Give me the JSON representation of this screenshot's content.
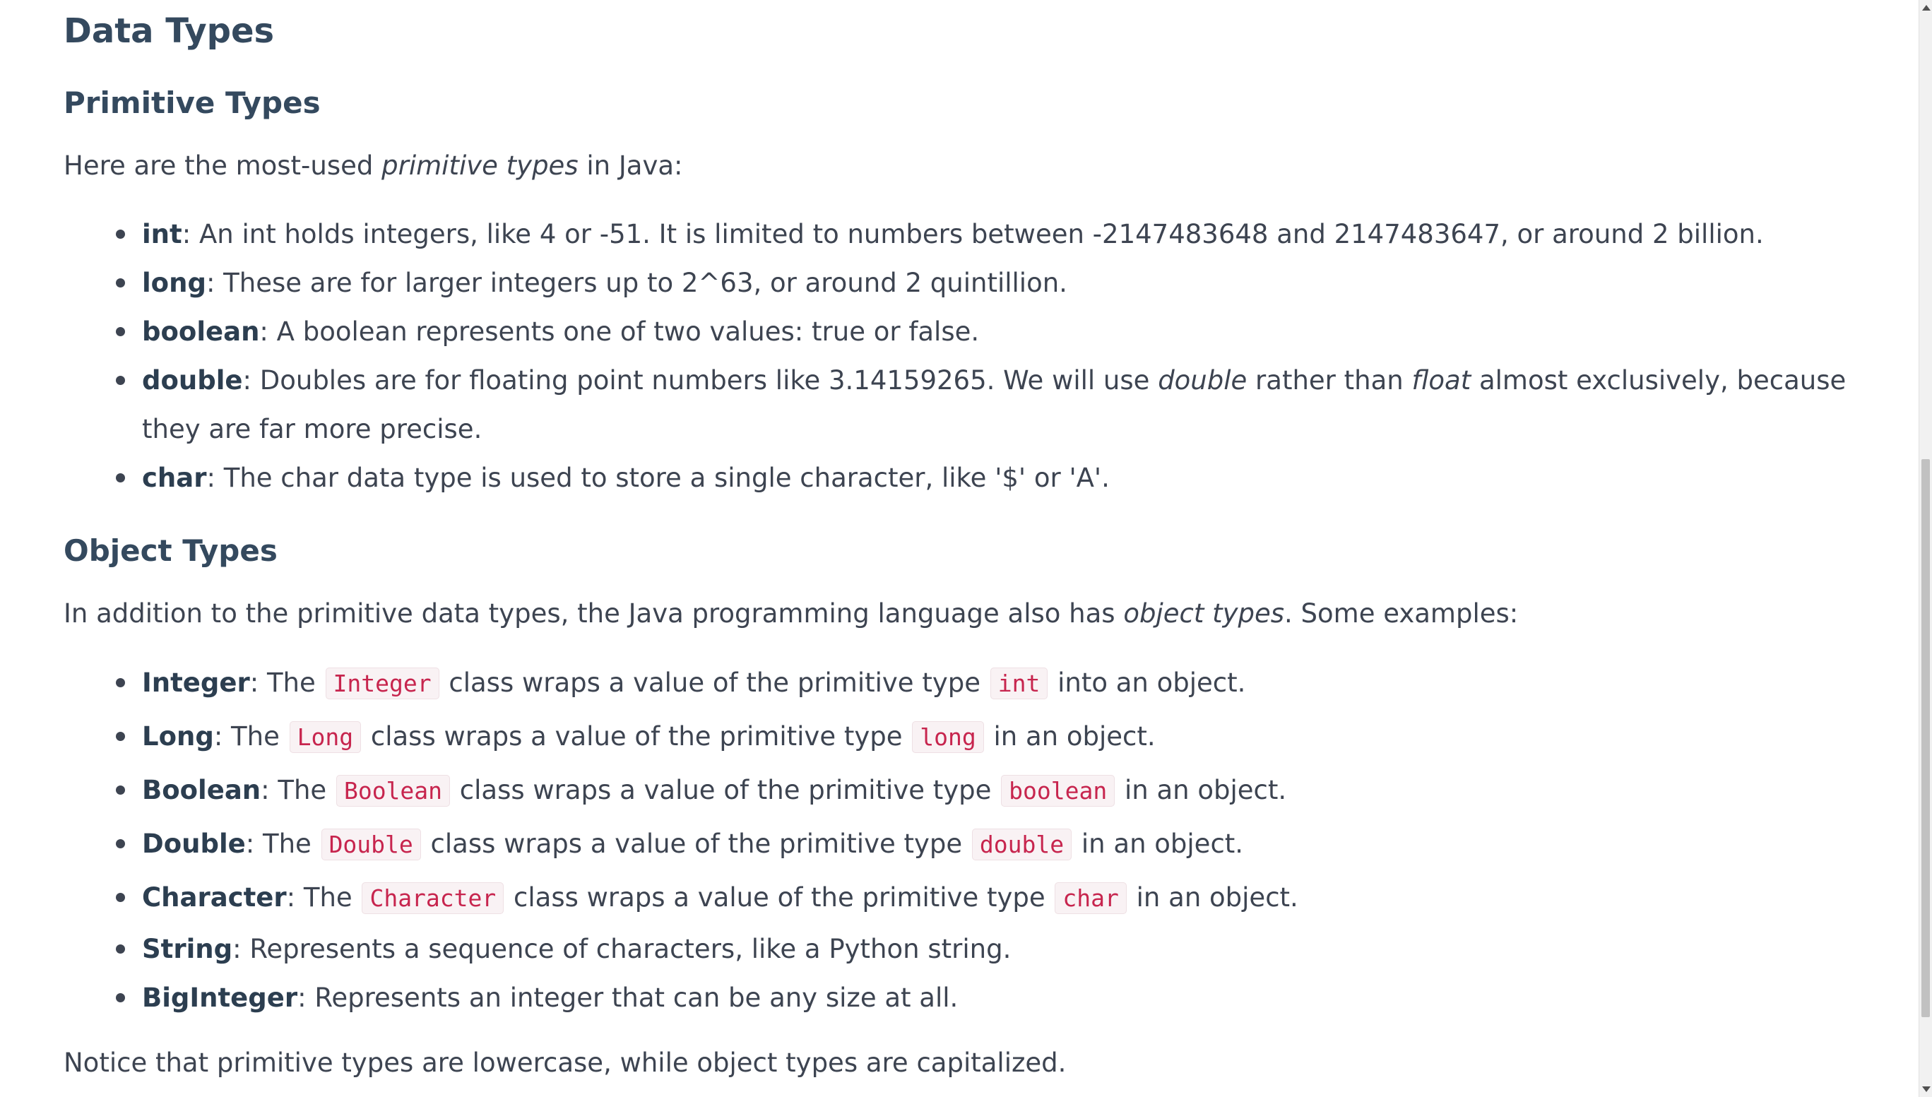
{
  "heading": "Data Types",
  "primitive": {
    "heading": "Primitive Types",
    "intro": {
      "before": "Here are the most-used ",
      "em": "primitive types",
      "after": " in Java:"
    },
    "items": [
      {
        "term": "int",
        "text": ": An int holds integers, like 4 or -51. It is limited to numbers between -2147483648 and 2147483647, or around 2 billion."
      },
      {
        "term": "long",
        "text": ": These are for larger integers up to 2^63, or around 2 quintillion."
      },
      {
        "term": "boolean",
        "text": ": A boolean represents one of two values: true or false."
      },
      {
        "term": "double",
        "text_a": ":  Doubles are for floating point numbers like 3.14159265. We will use ",
        "em_a": "double",
        "text_b": " rather than ",
        "em_b": "float",
        "text_c": " almost exclusively, because they are far more precise."
      },
      {
        "term": "char",
        "text": ": The char data type is used to store a single character, like '$' or 'A'."
      }
    ]
  },
  "object": {
    "heading": "Object Types",
    "intro": {
      "before": "In addition to the primitive data types, the Java programming language also has ",
      "em": "object types",
      "after": ". Some examples:"
    },
    "wrappers": [
      {
        "term": "Integer",
        "pre": ": The ",
        "code1": "Integer",
        "mid": " class wraps a value of the primitive type ",
        "code2": "int",
        "post": " into an object."
      },
      {
        "term": "Long",
        "pre": ": The ",
        "code1": "Long",
        "mid": " class wraps a value of the primitive type ",
        "code2": "long",
        "post": " in an object."
      },
      {
        "term": "Boolean",
        "pre": ": The ",
        "code1": "Boolean",
        "mid": " class wraps a value of the primitive type ",
        "code2": "boolean",
        "post": " in an object."
      },
      {
        "term": "Double",
        "pre": ": The ",
        "code1": "Double",
        "mid": " class wraps a value of the primitive type ",
        "code2": "double",
        "post": " in an object."
      },
      {
        "term": "Character",
        "pre": ": The ",
        "code1": "Character",
        "mid": " class wraps a value of the primitive type ",
        "code2": "char",
        "post": " in an object."
      }
    ],
    "others": [
      {
        "term": "String",
        "text": ": Represents a sequence of characters, like a Python string."
      },
      {
        "term": "BigInteger",
        "text": ": Represents an integer that can be any size at all."
      }
    ],
    "note": "Notice that primitive types are lowercase, while object types are capitalized."
  }
}
